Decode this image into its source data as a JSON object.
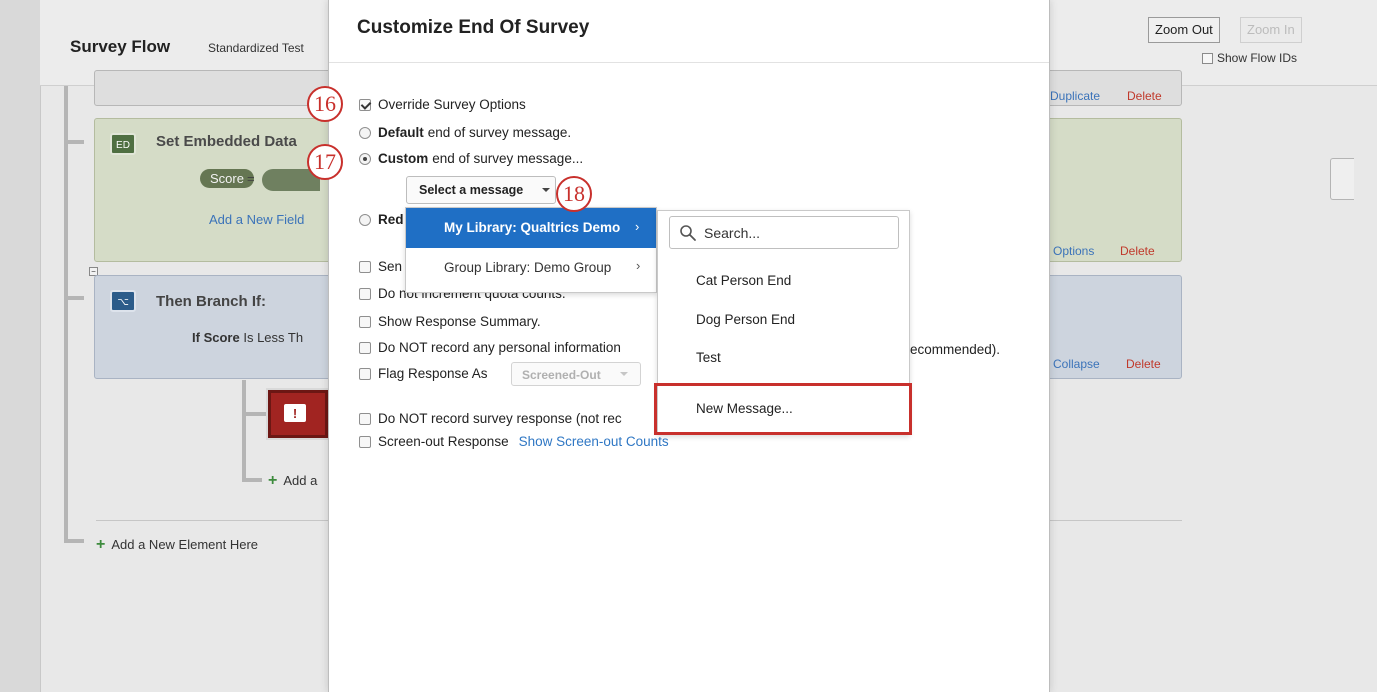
{
  "flow": {
    "title": "Survey Flow",
    "subtitle": "Standardized Test",
    "zoom_out": "Zoom Out",
    "zoom_in": "Zoom In",
    "show_flow_ids": "Show Flow IDs",
    "embedded_title": "Set Embedded Data",
    "score_pill": "Score",
    "eq": "=",
    "add_field": "Add a New Field",
    "branch_title": "Then Branch If:",
    "if_label": "If",
    "if_field": "Score",
    "if_condition": "Is Less Th",
    "duplicate": "Duplicate",
    "delete": "Delete",
    "options": "Options",
    "collapse": "Collapse",
    "add_inner": "Add a",
    "add_element": "Add a New Element Here",
    "ed_icon": "ED"
  },
  "modal": {
    "title": "Customize End Of Survey",
    "override_label": "Override Survey Options",
    "override_checked": true,
    "default_bold": "Default",
    "default_rest": "end of survey message.",
    "custom_bold": "Custom",
    "custom_rest": "end of survey message...",
    "select_label": "Select a message",
    "redirect_label": "Red",
    "send_label": "Sen",
    "no_quota": "Do not increment quota counts.",
    "show_summary": "Show Response Summary.",
    "no_personal": "Do NOT record any personal information",
    "no_personal_tail": "ecommended).",
    "flag_as": "Flag Response As",
    "flag_value": "Screened-Out",
    "no_record": "Do NOT record survey response (not rec",
    "screen_out": "Screen-out Response",
    "show_counts": "Show Screen-out Counts"
  },
  "library_menu": {
    "items": [
      {
        "label": "My Library: Qualtrics Demo",
        "selected": true
      },
      {
        "label": "Group Library: Demo Group",
        "selected": false
      }
    ]
  },
  "message_menu": {
    "search_placeholder": "Search...",
    "items": [
      "Cat Person End",
      "Dog Person End",
      "Test",
      "New Message..."
    ]
  },
  "steps": [
    "16",
    "17",
    "18"
  ],
  "colors": {
    "accent_red": "#c8302c",
    "selection_blue": "#1f6fc5",
    "link_blue": "#2f77c4"
  }
}
